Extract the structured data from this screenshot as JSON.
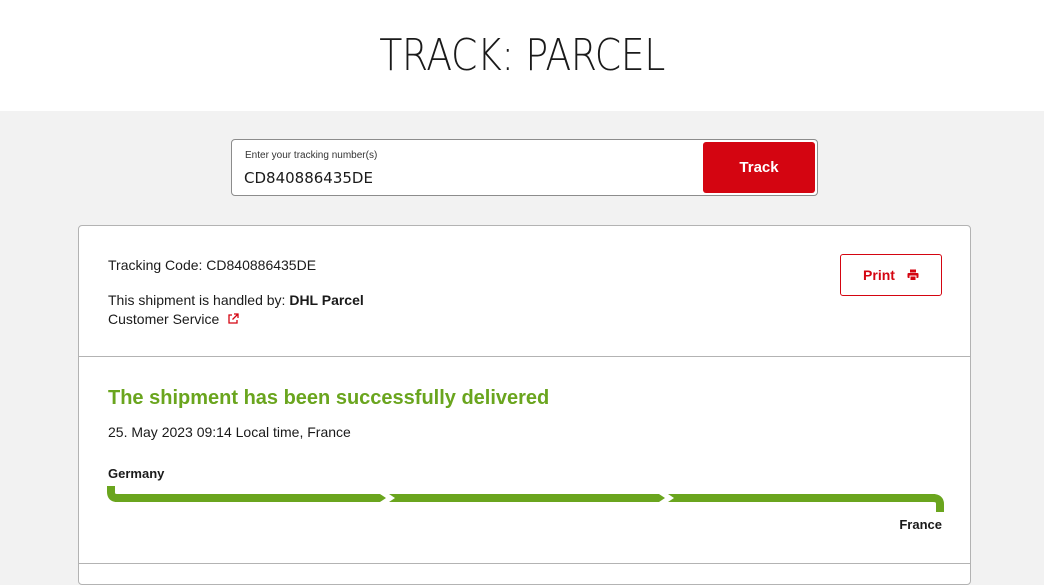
{
  "page": {
    "title": "TRACK: PARCEL"
  },
  "search": {
    "label": "Enter your tracking number(s)",
    "value": "CD840886435DE",
    "button_label": "Track"
  },
  "shipment": {
    "tracking_code_label": "Tracking Code: CD840886435DE",
    "handled_by_prefix": "This shipment is handled by: ",
    "handled_by_name": "DHL Parcel",
    "customer_service_label": "Customer Service",
    "print_label": "Print",
    "status_title": "The shipment has been successfully delivered",
    "status_date": "25. May 2023 09:14 Local time, France",
    "origin": "Germany",
    "destination": "France",
    "progress_segments_complete": 3,
    "progress_segments_total": 3
  },
  "colors": {
    "brand_red": "#d40511",
    "success_green": "#6aa51e"
  }
}
